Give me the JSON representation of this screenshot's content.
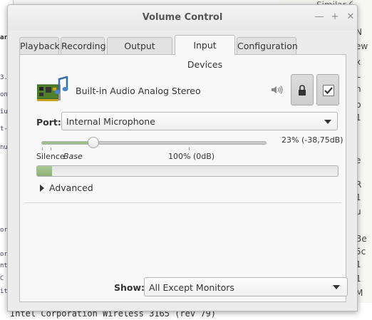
{
  "window": {
    "title": "Volume Control",
    "controls": {
      "minimize": "—",
      "maximize": "+",
      "close": "✕"
    }
  },
  "tabs": [
    {
      "label": "Playback",
      "active": false
    },
    {
      "label": "Recording",
      "active": false
    },
    {
      "label": "Output Devices",
      "active": false
    },
    {
      "label": "Input Devices",
      "active": true
    },
    {
      "label": "Configuration",
      "active": false
    }
  ],
  "device": {
    "name": "Built-in Audio Analog Stereo",
    "icon": "sound-card-icon",
    "volume_icon": "speaker-icon",
    "lock_icon": "lock-channels-icon",
    "default_icon": "checkmark-icon",
    "port_label": "Port:",
    "port_value": "Internal Microphone",
    "volume_fraction": 0.23,
    "volume_readout": "23% (-38,75dB)",
    "scale_labels": {
      "silence": "Silence",
      "base": "Base",
      "hundred": "100% (0dB)"
    },
    "level_fraction": 0.05,
    "advanced_label": "Advanced"
  },
  "show": {
    "label": "Show:",
    "value": "All Except Monitors"
  },
  "background": {
    "right_top_text": "Similar Ques",
    "terminal_text": "Intel Corporation Wireless 3165 (rev 79)"
  },
  "colors": {
    "level_fill": "#9dbf88",
    "accent_green": "#8eb078"
  }
}
